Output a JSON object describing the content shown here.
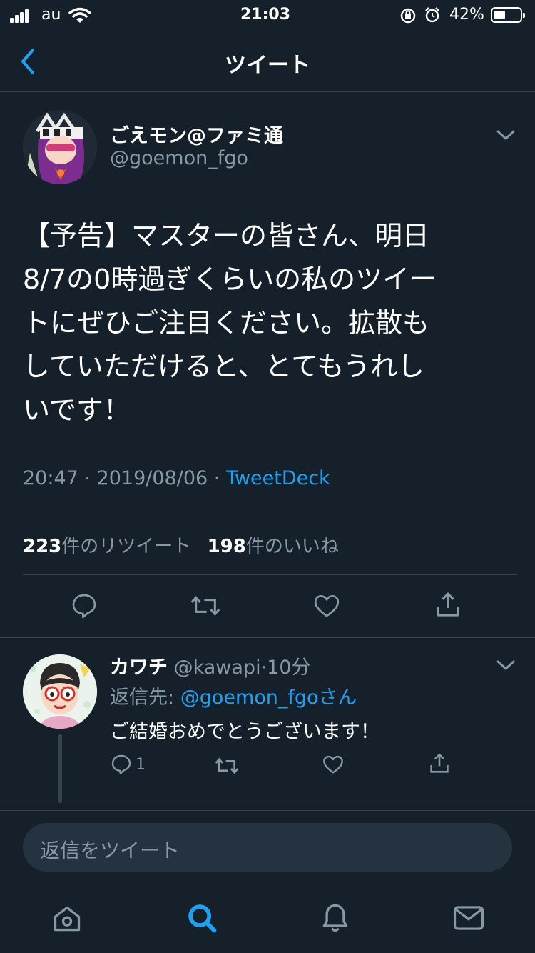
{
  "status_bar": {
    "carrier": "au",
    "time": "21:03",
    "battery": "42%"
  },
  "header": {
    "title": "ツイート"
  },
  "tweet": {
    "display_name": "ごえモン@ファミ通",
    "handle": "@goemon_fgo",
    "text_lines": [
      "【予告】マスターの皆さん、明日",
      "8/7の0時過ぎくらいの私のツイー",
      "トにぜひご注目ください。拡散も",
      "していただけると、とてもうれし",
      "いです！"
    ],
    "time": "20:47",
    "date": "2019/08/06",
    "source": "TweetDeck",
    "retweet_count": "223",
    "retweet_label": "件のリツイート",
    "like_count": "198",
    "like_label": "件のいいね"
  },
  "reply": {
    "display_name": "カワチ",
    "handle": "@kawapi",
    "time_ago": "10分",
    "replying_to_label": "返信先: ",
    "replying_to_handle": "@goemon_fgoさん",
    "text": "ご結婚おめでとうございます！",
    "reply_count": "1"
  },
  "reply_box": {
    "placeholder": "返信をツイート"
  },
  "colors": {
    "background": "#15202b",
    "accent": "#1da1f2",
    "muted": "#8899a6",
    "divider": "#38444d"
  },
  "tab_bar": {
    "items": [
      "home-icon",
      "search-icon",
      "notifications-icon",
      "messages-icon"
    ],
    "active": "search-icon"
  }
}
